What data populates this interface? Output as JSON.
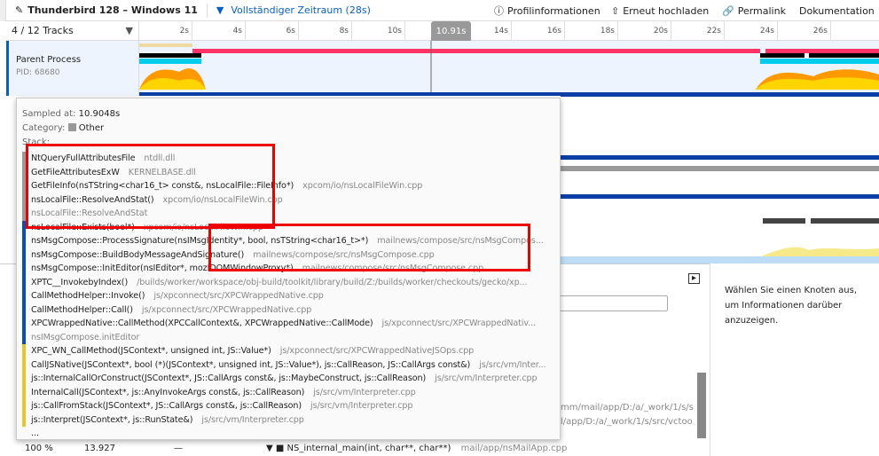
{
  "header": {
    "title": "Thunderbird 128 – Windows 11",
    "range": "Vollständiger Zeitraum (28s)",
    "buttons": [
      "Profilinformationen",
      "Erneut hochladen",
      "Permalink",
      "Dokumentation"
    ]
  },
  "tracks": {
    "count_label": "4 / 12 Tracks",
    "ticks": [
      "2s",
      "4s",
      "6s",
      "8s",
      "10s",
      "14s",
      "16s",
      "18s",
      "20s",
      "22s",
      "24s",
      "26s"
    ],
    "selected_time": "10.91s",
    "parent": {
      "name": "Parent Process",
      "pid": "PID: 68680"
    }
  },
  "tooltip": {
    "sampled_label": "Sampled at:",
    "sampled_value": "10.9048s",
    "category_label": "Category:",
    "category_value": "Other",
    "stack_label": "Stack:",
    "stack": [
      {
        "fn": "NtQueryFullAttributesFile",
        "file": "ntdll.dll",
        "cat": "grey"
      },
      {
        "fn": "GetFileAttributesExW",
        "file": "KERNELBASE.dll",
        "cat": "grey"
      },
      {
        "fn": "GetFileInfo(nsTString<char16_t> const&, nsLocalFile::FileInfo*)",
        "file": "xpcom/io/nsLocalFileWin.cpp",
        "cat": "grey"
      },
      {
        "fn": "nsLocalFile::ResolveAndStat()",
        "file": "xpcom/io/nsLocalFileWin.cpp",
        "cat": "grey"
      },
      {
        "fn": "nsLocalFile::ResolveAndStat",
        "file": "",
        "cat": "grey",
        "dim": true
      },
      {
        "fn": "nsLocalFile::Exists(bool*)",
        "file": "xpcom/io/nsLocalFileWin.cpp",
        "cat": "blue"
      },
      {
        "fn": "nsMsgCompose::ProcessSignature(nsIMsgIdentity*, bool, nsTString<char16_t>*)",
        "file": "mailnews/compose/src/nsMsgCompos...",
        "cat": "blue"
      },
      {
        "fn": "nsMsgCompose::BuildBodyMessageAndSignature()",
        "file": "mailnews/compose/src/nsMsgCompose.cpp",
        "cat": "blue"
      },
      {
        "fn": "nsMsgCompose::InitEditor(nsIEditor*, mozIDOMWindowProxy*)",
        "file": "mailnews/compose/src/nsMsgCompose.cpp",
        "cat": "blue"
      },
      {
        "fn": "XPTC__InvokebyIndex()",
        "file": "/builds/worker/workspace/obj-build/toolkit/library/build/Z:/builds/worker/checkouts/gecko/xp...",
        "cat": "blue"
      },
      {
        "fn": "CallMethodHelper::Invoke()",
        "file": "js/xpconnect/src/XPCWrappedNative.cpp",
        "cat": "blue"
      },
      {
        "fn": "CallMethodHelper::Call()",
        "file": "js/xpconnect/src/XPCWrappedNative.cpp",
        "cat": "blue"
      },
      {
        "fn": "XPCWrappedNative::CallMethod(XPCCallContext&, XPCWrappedNative::CallMode)",
        "file": "js/xpconnect/src/XPCWrappedNativ...",
        "cat": "blue"
      },
      {
        "fn": "nsIMsgCompose.initEditor",
        "file": "",
        "cat": "blue",
        "dim": true
      },
      {
        "fn": "XPC_WN_CallMethod(JSContext*, unsigned int, JS::Value*)",
        "file": "js/xpconnect/src/XPCWrappedNativeJSOps.cpp",
        "cat": "yellow"
      },
      {
        "fn": "CallJSNative(JSContext*, bool (*)(JSContext*, unsigned int, JS::Value*), js::CallReason, JS::CallArgs const&)",
        "file": "js/src/vm/Inter...",
        "cat": "yellow"
      },
      {
        "fn": "js::InternalCallOrConstruct(JSContext*, JS::CallArgs const&, js::MaybeConstruct, js::CallReason)",
        "file": "js/src/vm/Interpreter.cpp",
        "cat": "yellow"
      },
      {
        "fn": "InternalCall(JSContext*, js::AnyInvokeArgs const&, js::CallReason)",
        "file": "js/src/vm/Interpreter.cpp",
        "cat": "yellow"
      },
      {
        "fn": "js::CallFromStack(JSContext*, JS::CallArgs const&, js::CallReason)",
        "file": "js/src/vm/Interpreter.cpp",
        "cat": "yellow"
      },
      {
        "fn": "js::Interpret(JSContext*, js::RunState&)",
        "file": "js/src/vm/Interpreter.cpp",
        "cat": "yellow"
      },
      {
        "fn": "...",
        "file": "",
        "cat": "none"
      }
    ]
  },
  "calltree": {
    "row_pct": "100 %",
    "row_ms": "13.927",
    "row_self": "—",
    "row_fn": "NS_internal_main(int, char**, char**)",
    "row_file": "mail/app/nsMailApp.cpp",
    "partial1": "mm/mail/app/D:/a/_work/1/s/s",
    "partial2": "l/app/D:/a/_work/1/s/src/vctoo"
  },
  "sidebar": {
    "text": "Wählen Sie einen Knoten aus, um Informationen darüber anzuzeigen."
  },
  "colors": {
    "grey": "#9a9a9a",
    "blue": "#0b4fb0",
    "yellow": "#e5c530",
    "none": "transparent",
    "accent": "#0b5fc4"
  }
}
